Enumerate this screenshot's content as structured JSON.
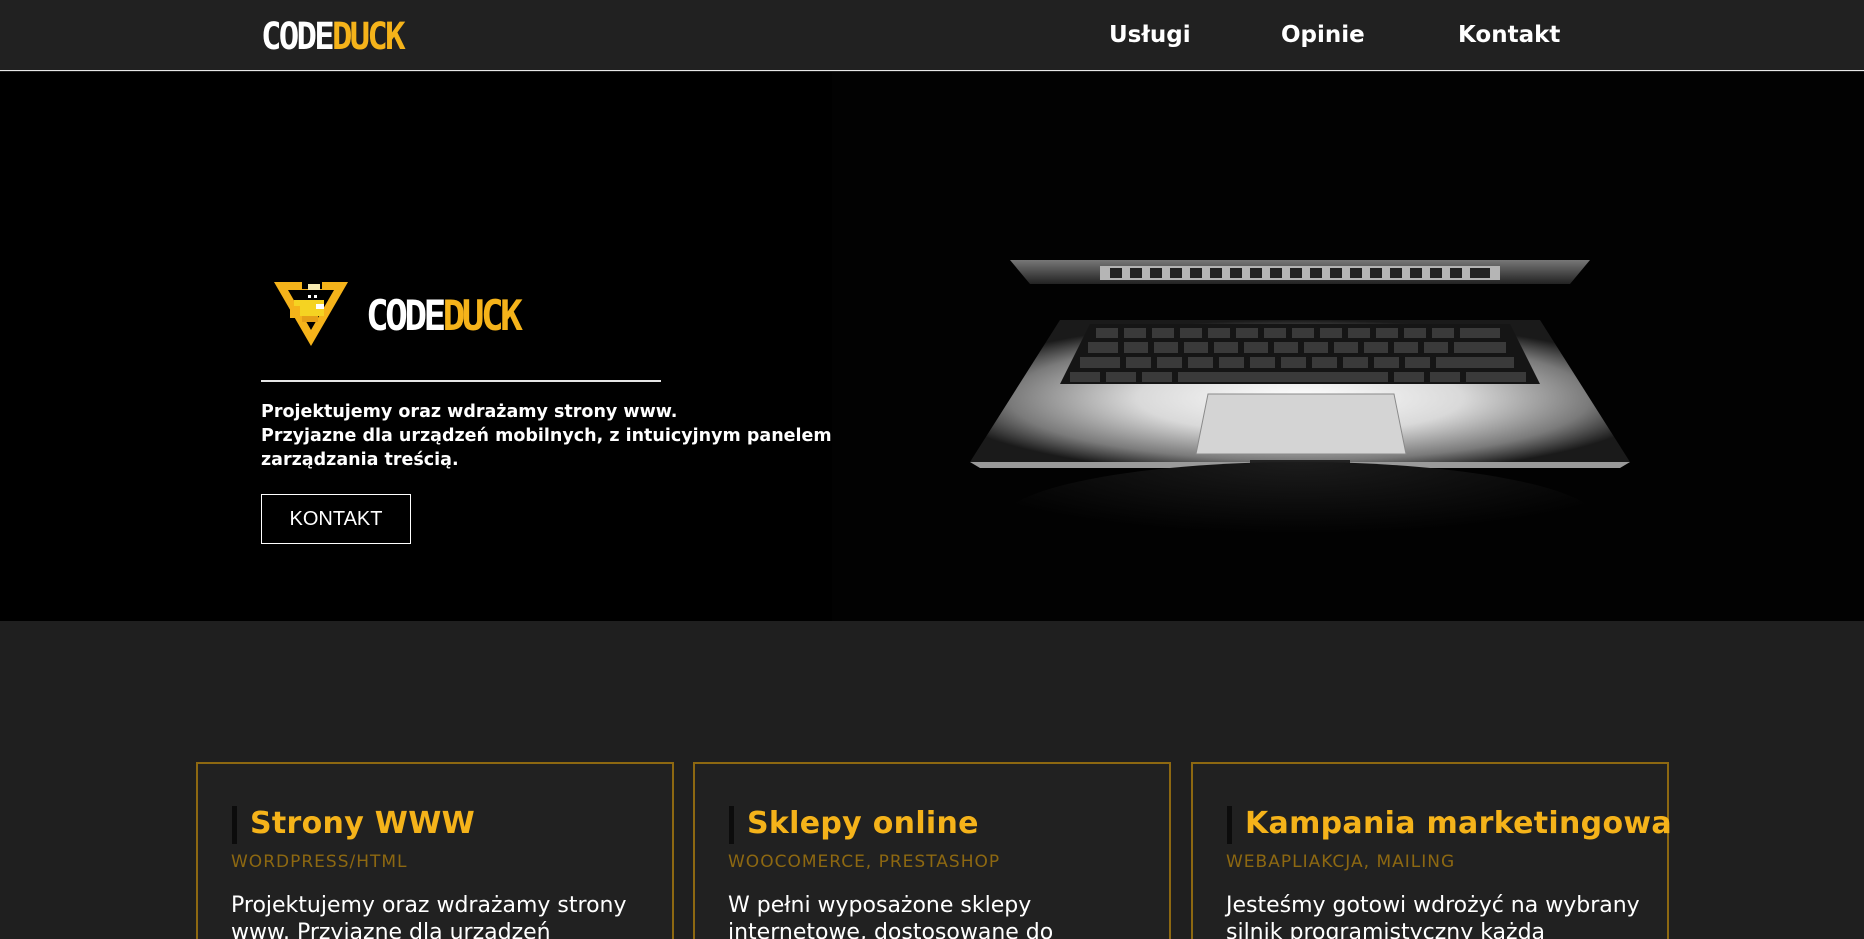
{
  "brand": {
    "code": "CODE",
    "duck": "DUCK"
  },
  "colors": {
    "accent": "#f5b31a",
    "accent_dark": "#8d6811",
    "bg": "#1f1f1f",
    "hero_bg": "#000000"
  },
  "nav": {
    "items": [
      {
        "label": "Usługi"
      },
      {
        "label": "Opinie"
      },
      {
        "label": "Kontakt"
      }
    ]
  },
  "hero": {
    "logo_code": "CODE",
    "logo_duck": "DUCK",
    "emblem_icon": "duck-triangle-emblem",
    "lines": [
      "Projektujemy oraz wdrażamy strony www.",
      "Przyjazne dla urządzeń mobilnych, z intuicyjnym panelem",
      "zarządzania treścią."
    ],
    "button_label": "KONTAKT",
    "image_icon": "laptop-image"
  },
  "services": [
    {
      "title": "Strony WWW",
      "subtitle": "WORDPRESS/HTML",
      "desc_lines": [
        "Projektujemy oraz wdrażamy strony",
        "www. Przyjazne dla urządzeń"
      ]
    },
    {
      "title": "Sklepy online",
      "subtitle": "WOOCOMERCE, PRESTASHOP",
      "desc_lines": [
        "W pełni wyposażone sklepy",
        "internetowe, dostosowane do"
      ]
    },
    {
      "title": "Kampania marketingowa",
      "subtitle": "WEBAPLIAKCJA, MAILING",
      "desc_lines": [
        "Jesteśmy gotowi wdrożyć na wybrany",
        "silnik programistyczny każdą"
      ]
    }
  ]
}
